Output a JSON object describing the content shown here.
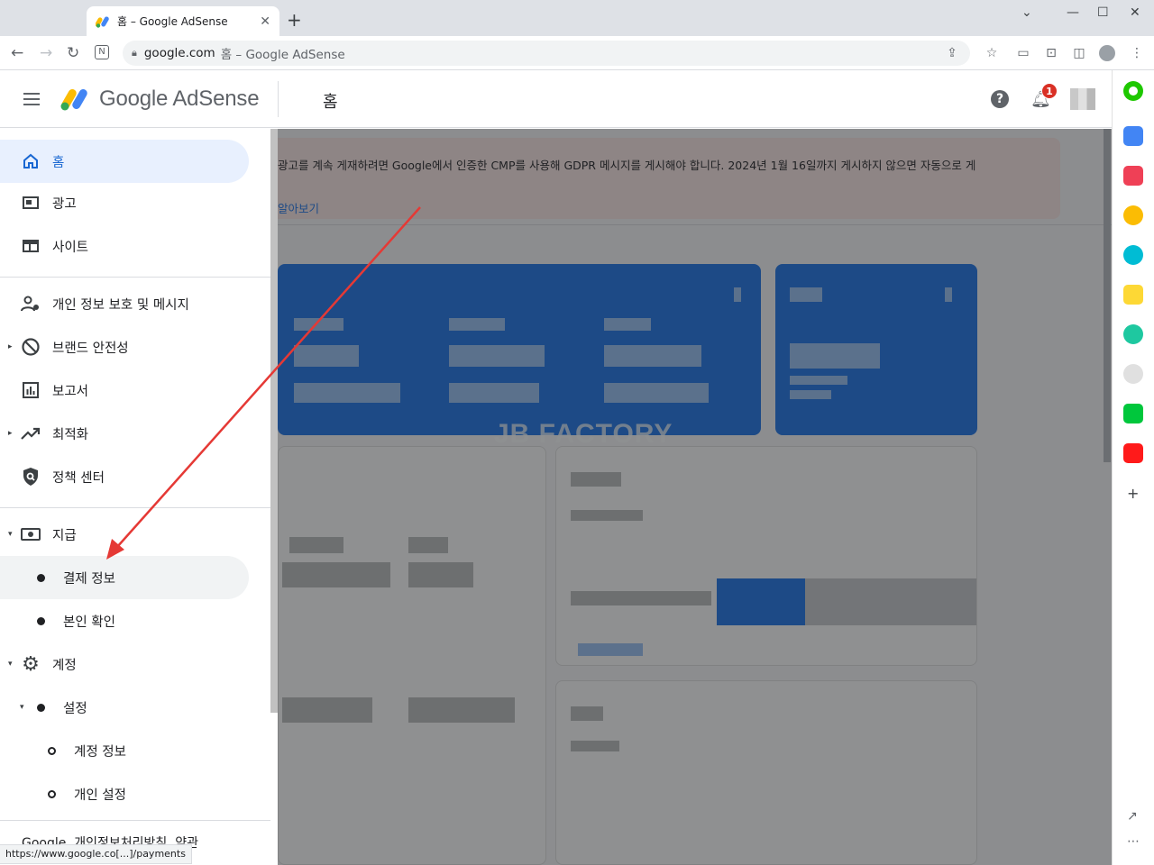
{
  "browser": {
    "tab_title": "홈 – Google AdSense",
    "url_host": "google.com",
    "url_rest": "홈 – Google AdSense",
    "status_url": "https://www.google.co[...]/payments"
  },
  "header": {
    "brand": "Google AdSense",
    "page_title": "홈",
    "help_icon": "?",
    "notification_count": "1"
  },
  "sidebar": {
    "items": [
      {
        "label": "홈",
        "icon": "home-icon"
      },
      {
        "label": "광고",
        "icon": "ads-icon"
      },
      {
        "label": "사이트",
        "icon": "sites-icon"
      },
      {
        "label": "개인 정보 보호 및 메시지",
        "icon": "privacy-messaging-icon"
      },
      {
        "label": "브랜드 안전성",
        "icon": "block-icon"
      },
      {
        "label": "보고서",
        "icon": "reports-icon"
      },
      {
        "label": "최적화",
        "icon": "trending-up-icon"
      },
      {
        "label": "정책 센터",
        "icon": "policy-shield-icon"
      },
      {
        "label": "지급",
        "icon": "payments-icon"
      },
      {
        "label": "결제 정보",
        "icon": "dot-icon"
      },
      {
        "label": "본인 확인",
        "icon": "dot-icon"
      },
      {
        "label": "계정",
        "icon": "gear-icon"
      },
      {
        "label": "설정",
        "icon": "dot-icon"
      },
      {
        "label": "계정 정보",
        "icon": "ring-icon"
      },
      {
        "label": "개인 설정",
        "icon": "ring-icon"
      }
    ],
    "footer": "Google  개인정보처리방침  약관"
  },
  "content": {
    "gdpr_message": "광고를 계속 게재하려면 Google에서 인증한 CMP를 사용해 GDPR 메시지를 게시해야 합니다. 2024년 1월 16일까지 게시하지 않으면 자동으로 게",
    "gdpr_link": "알아보기",
    "watermark": "JB FACTORY"
  },
  "colors": {
    "accent": "#1a73e8",
    "active_bg": "#e8f0fe",
    "alert_bg": "#fce8e6",
    "arrow": "#e53935"
  }
}
